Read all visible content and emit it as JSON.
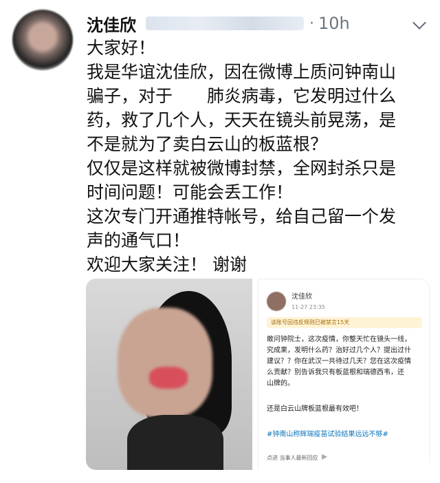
{
  "account": {
    "name": "沈佳欣",
    "handle": "",
    "dot": "·",
    "time": "10h"
  },
  "tweet": {
    "lines": [
      "大家好！",
      "我是华谊沈佳欣，因在微博上质问钟南山",
      "骗子，对于　　肺炎病毒，它发明过什么",
      "药，救了几个人，天天在镜头前晃荡，是",
      "不是就为了卖白云山的板蓝根？",
      "仅仅是这样就被微博封禁，全网封杀只是",
      "时间问题！可能会丢工作！",
      "这次专门开通推特帐号，给自己留一个发",
      "声的通气口！",
      "欢迎大家关注！ 谢谢"
    ]
  },
  "media": {
    "post": {
      "name": "沈佳欣",
      "time": "11-27 23:35",
      "notice": "该账号因违反规则已被禁言15天",
      "body": [
        "敢问钟院士，这次疫情，你整天忙在镜头一线，",
        "究成果，发明什么药？治好过几个人？提出过什",
        "建议？？你在武汉一共待过几天？您在这次疫情",
        "么贡献？别告诉我只有板蓝根和瑞德西韦，还",
        "山牌的。"
      ],
      "caption": "还是白云山牌板蓝根最有效吧！",
      "tag": "#钟南山称辉瑞疫苗试验结果远远不够#",
      "footer": "点进 当事人最新回应"
    }
  },
  "icons": {
    "avatar": "avatar",
    "chevron": "chevron-down-icon"
  }
}
